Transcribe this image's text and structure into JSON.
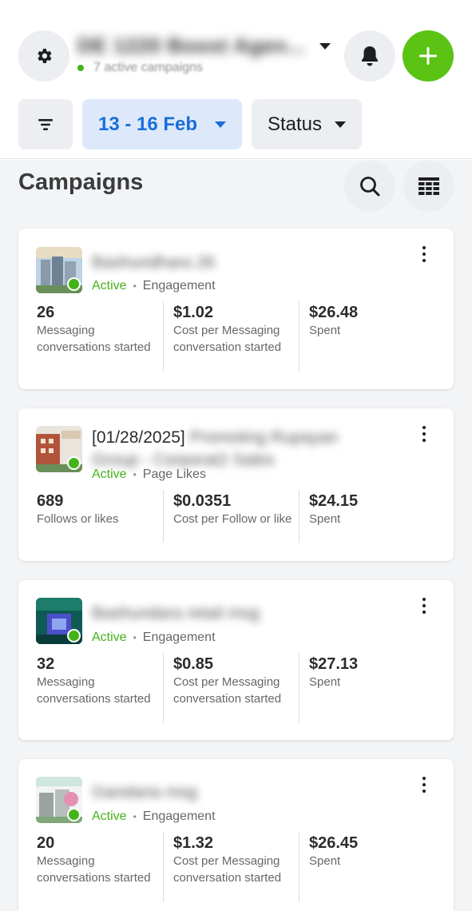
{
  "header": {
    "account_name": "DE 1220 Boost Agen...",
    "active_campaigns": "7 active campaigns"
  },
  "filters": {
    "date_range": "13 - 16 Feb",
    "status_label": "Status"
  },
  "campaigns_title": "Campaigns",
  "campaigns": [
    {
      "name": "Bashundhara 26",
      "name_blurred": true,
      "status": "Active",
      "objective": "Engagement",
      "metrics": [
        {
          "value": "26",
          "label": "Messaging conversations started"
        },
        {
          "value": "$1.02",
          "label": "Cost per Messaging conversation started"
        },
        {
          "value": "$26.48",
          "label": "Spent"
        }
      ]
    },
    {
      "name_prefix": "[01/28/2025]",
      "name": "Promoting Rupayan Group - Corporat2 Sales",
      "name_blurred": true,
      "status": "Active",
      "objective": "Page Likes",
      "metrics": [
        {
          "value": "689",
          "label": "Follows or likes"
        },
        {
          "value": "$0.0351",
          "label": "Cost per Follow or like"
        },
        {
          "value": "$24.15",
          "label": "Spent"
        }
      ]
    },
    {
      "name": "Bashundara retail msg",
      "name_blurred": true,
      "status": "Active",
      "objective": "Engagement",
      "metrics": [
        {
          "value": "32",
          "label": "Messaging conversations started"
        },
        {
          "value": "$0.85",
          "label": "Cost per Messaging conversation started"
        },
        {
          "value": "$27.13",
          "label": "Spent"
        }
      ]
    },
    {
      "name": "Gandaria msg",
      "name_blurred": true,
      "status": "Active",
      "objective": "Engagement",
      "metrics": [
        {
          "value": "20",
          "label": "Messaging conversations started"
        },
        {
          "value": "$1.32",
          "label": "Cost per Messaging conversation started"
        },
        {
          "value": "$26.45",
          "label": "Spent"
        }
      ]
    }
  ],
  "icons": {
    "settings": "gear-icon",
    "notifications": "bell-icon",
    "create": "plus-icon",
    "filter": "filter-icon",
    "search": "search-icon",
    "table_view": "table-icon",
    "more": "more-vertical-icon"
  },
  "colors": {
    "accent_green": "#5ac314",
    "active_green": "#44b319",
    "date_chip_bg": "#dde9fb",
    "date_chip_text": "#1a6ed8"
  }
}
